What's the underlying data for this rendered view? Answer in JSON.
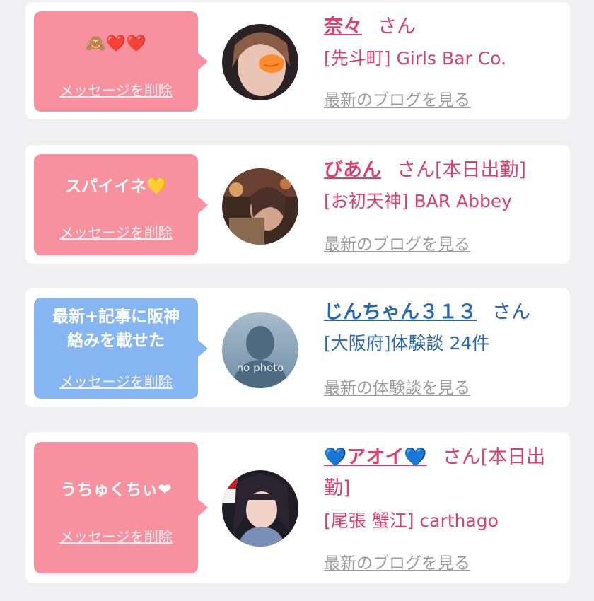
{
  "cards": [
    {
      "message": "🙈❤️❤️",
      "delete_label": "メッセージを削除",
      "name": "奈々",
      "honorific": "さん",
      "shop": "[先斗町] Girls Bar Co.",
      "link_label": "最新のブログを見る"
    },
    {
      "message": "スパイイネ💛",
      "delete_label": "メッセージを削除",
      "name": "びあん",
      "honorific": "さん[本日出勤]",
      "shop": "[お初天神] BAR Abbey",
      "link_label": "最新のブログを見る"
    },
    {
      "message_line1": "最新+記事に阪神",
      "message_line2": "絡みを載せた",
      "delete_label": "メッセージを削除",
      "name": "じんちゃん３１３",
      "honorific": "さん",
      "shop": "[大阪府]体験談 24件",
      "avatar_text": "no photo",
      "link_label": "最新の体験談を見る"
    },
    {
      "message": "うちゅくちぃ❤",
      "delete_label": "メッセージを削除",
      "name_heart": "💙",
      "name": "アオイ",
      "honorific_line1": "さん[本日出",
      "honorific_line2": "勤]",
      "shop": "[尾張 蟹江] carthago",
      "link_label": "最新のブログを見る"
    }
  ],
  "colors": {
    "pink_bubble": "#f7919f",
    "blue_bubble": "#86b6f1",
    "pink_text": "#d8416b",
    "blue_text": "#2b68b2",
    "link_gray": "#9b9b9b",
    "background": "#f0eff1"
  }
}
